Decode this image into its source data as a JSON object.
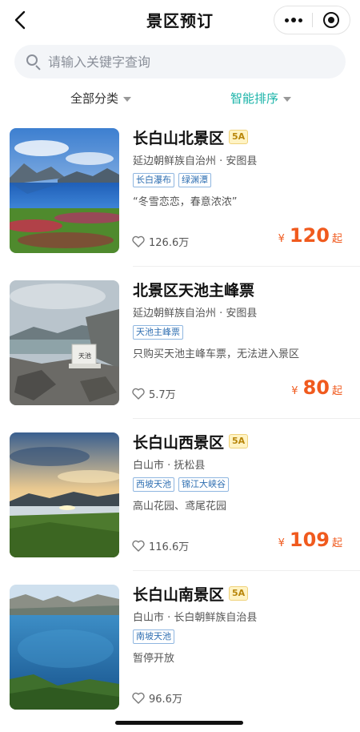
{
  "header": {
    "title": "景区预订",
    "back_icon": "back-arrow-icon",
    "more_icon": "more-dots-icon",
    "close_icon": "close-target-icon"
  },
  "search": {
    "placeholder": "请输入关键字查询",
    "value": ""
  },
  "filters": {
    "category_label": "全部分类",
    "sort_label": "智能排序",
    "accent_color": "#19b3a8"
  },
  "items": [
    {
      "name": "长白山北景区",
      "rating_badge": "5A",
      "location": "延边朝鲜族自治州 · 安图县",
      "tags": [
        "长白瀑布",
        "绿渊潭"
      ],
      "description": "“冬雪恋恋，春意浓浓”",
      "favorites": "126.6万",
      "price_symbol": "¥",
      "price": "120",
      "price_suffix": "起"
    },
    {
      "name": "北景区天池主峰票",
      "rating_badge": "",
      "location": "延边朝鲜族自治州 · 安图县",
      "tags": [
        "天池主峰票"
      ],
      "description": "只购买天池主峰车票，无法进入景区",
      "favorites": "5.7万",
      "price_symbol": "¥",
      "price": "80",
      "price_suffix": "起"
    },
    {
      "name": "长白山西景区",
      "rating_badge": "5A",
      "location": "白山市 · 抚松县",
      "tags": [
        "西坡天池",
        "锦江大峡谷"
      ],
      "description": "高山花园、鸢尾花园",
      "favorites": "116.6万",
      "price_symbol": "¥",
      "price": "109",
      "price_suffix": "起"
    },
    {
      "name": "长白山南景区",
      "rating_badge": "5A",
      "location": "白山市 · 长白朝鲜族自治县",
      "tags": [
        "南坡天池"
      ],
      "description": "暂停开放",
      "favorites": "96.6万",
      "price_symbol": "",
      "price": "",
      "price_suffix": ""
    }
  ],
  "colors": {
    "price": "#f05a1e",
    "tag": "#2f6fb2",
    "badge": "#b8860b"
  }
}
